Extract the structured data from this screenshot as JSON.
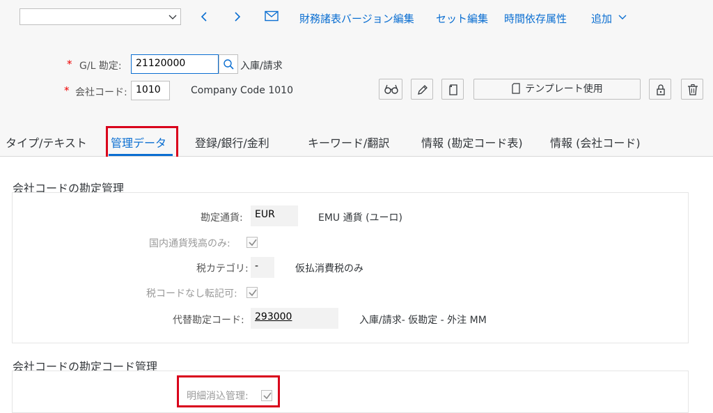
{
  "toolbar": {
    "dropdown_value": "",
    "links": [
      "財務諸表バージョン編集",
      "セット編集",
      "時間依存属性",
      "追加"
    ]
  },
  "header": {
    "gl_account": {
      "label": "G/L 勘定:",
      "value": "21120000",
      "description": "入庫/請求"
    },
    "company_code": {
      "label": "会社コード:",
      "value": "1010",
      "description": "Company Code 1010"
    },
    "template_button": "テンプレート使用"
  },
  "tabs": [
    {
      "label": "タイプ/テキスト",
      "selected": false
    },
    {
      "label": "管理データ",
      "selected": true
    },
    {
      "label": "登録/銀行/金利",
      "selected": false
    },
    {
      "label": "キーワード/翻訳",
      "selected": false
    },
    {
      "label": "情報 (勘定コード表)",
      "selected": false
    },
    {
      "label": "情報 (会社コード)",
      "selected": false
    }
  ],
  "sections": {
    "account_control": {
      "title": "会社コードの勘定管理",
      "fields": {
        "account_currency": {
          "label": "勘定通貨:",
          "value": "EUR",
          "description": "EMU 通貨 (ユーロ)"
        },
        "local_currency_balance_only": {
          "label": "国内通貨残高のみ:",
          "checked": true,
          "disabled": true
        },
        "tax_category": {
          "label": "税カテゴリ:",
          "value": "-",
          "description": "仮払消費税のみ"
        },
        "posting_without_tax_code": {
          "label": "税コードなし転記可:",
          "checked": true,
          "disabled": true
        },
        "alternative_account": {
          "label": "代替勘定コード:",
          "value": "293000",
          "description": "入庫/請求- 仮勘定 - 外注 MM"
        }
      }
    },
    "account_management": {
      "title": "会社コードの勘定コード管理",
      "fields": {
        "open_item_management": {
          "label": "明細消込管理:",
          "checked": true,
          "disabled": true
        }
      }
    }
  },
  "colors": {
    "accent": "#0a6ed1",
    "highlight": "#d9001b",
    "required": "#e00000"
  }
}
